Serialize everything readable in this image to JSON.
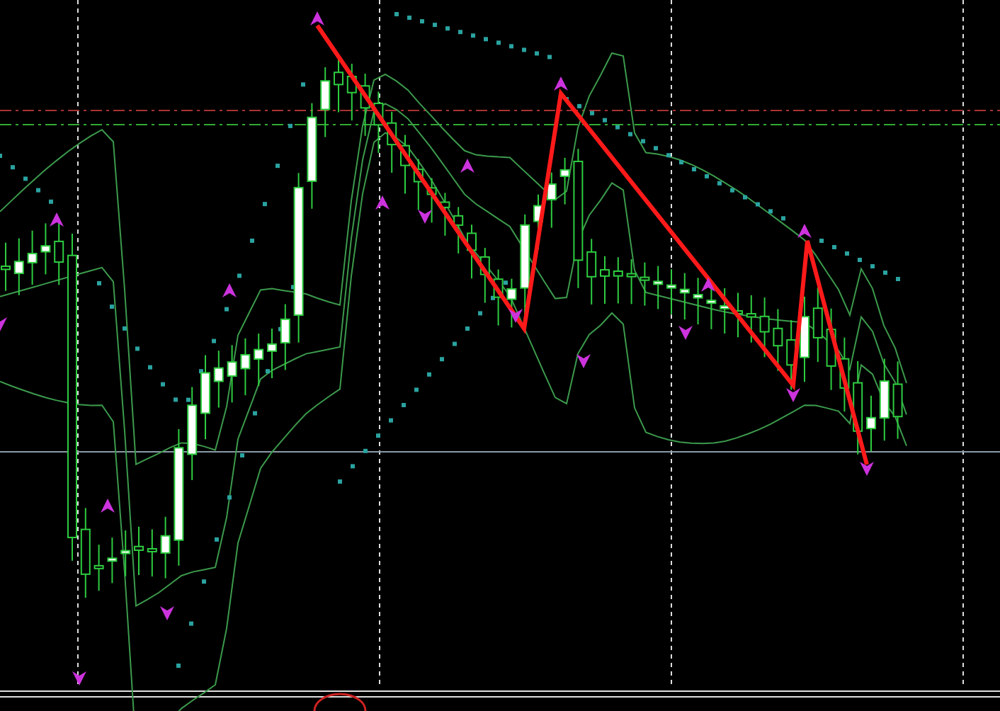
{
  "indicators": {
    "bollinger_bands": true,
    "parabolic_sar": true,
    "zigzag": true,
    "fractals": true
  }
}
